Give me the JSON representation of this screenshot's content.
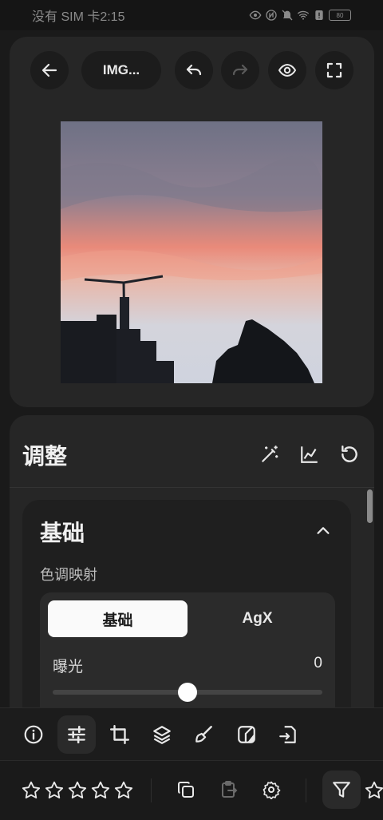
{
  "status_bar": {
    "carrier_time": "没有 SIM 卡2:15",
    "battery": "80"
  },
  "toolbar": {
    "back_icon": "arrow-left-icon",
    "file_name": "IMG...",
    "undo_icon": "undo-icon",
    "redo_icon": "redo-icon",
    "preview_icon": "eye-icon",
    "fullscreen_icon": "fullscreen-icon"
  },
  "adjust": {
    "title": "调整",
    "auto_icon": "magic-wand-icon",
    "histogram_icon": "histogram-icon",
    "reset_icon": "reset-icon"
  },
  "basic": {
    "title": "基础",
    "tone_mapping_label": "色调映射",
    "segments": [
      "基础",
      "AgX"
    ],
    "selected_segment": 0,
    "exposure_label": "曝光",
    "exposure_value": "0",
    "exposure_fraction": 0.5
  },
  "tools": [
    "info-icon",
    "adjust-sliders-icon",
    "crop-icon",
    "layers-icon",
    "brush-icon",
    "color-icon",
    "export-icon"
  ],
  "bottom_bar": {
    "rating_stars": 5,
    "copy_icon": "copy-icon",
    "paste_icon": "paste-icon",
    "settings_icon": "gear-icon",
    "filter_icon": "filter-icon"
  },
  "colors": {
    "background": "#1a1a1a",
    "card": "#262626",
    "accent_segment": "#fafafa"
  }
}
